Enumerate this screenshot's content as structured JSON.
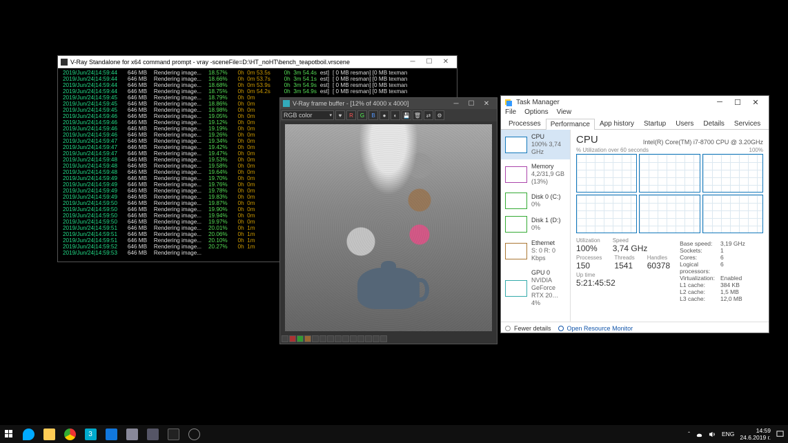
{
  "console": {
    "title": "V-Ray Standalone for x64 command prompt - vray  -sceneFile=D:\\HT_noHT\\bench_teapotboil.vrscene",
    "lines": [
      {
        "ts": "2019/Jun/24|14:59:44",
        "mb": "646",
        "pct": "18.57%",
        "t0": "0h  0m 53.5s",
        "t1": "0h  3m 54.4s",
        "tm": "[ 0 MB resman] [0 MB texman"
      },
      {
        "ts": "2019/Jun/24|14:59:44",
        "mb": "646",
        "pct": "18.66%",
        "t0": "0h  0m 53.7s",
        "t1": "0h  3m 54.1s",
        "tm": "[ 0 MB resman] [0 MB texman"
      },
      {
        "ts": "2019/Jun/24|14:59:44",
        "mb": "646",
        "pct": "18.68%",
        "t0": "0h  0m 53.9s",
        "t1": "0h  3m 54.9s",
        "tm": "[ 0 MB resman] [0 MB texman"
      },
      {
        "ts": "2019/Jun/24|14:59:44",
        "mb": "646",
        "pct": "18.75%",
        "t0": "0h  0m 54.2s",
        "t1": "0h  3m 54.9s",
        "tm": "[ 0 MB resman] [0 MB texman"
      },
      {
        "ts": "2019/Jun/24|14:59:45",
        "mb": "646",
        "pct": "18.79%",
        "t0": "0h  0m",
        "t1": "",
        "tm": ""
      },
      {
        "ts": "2019/Jun/24|14:59:45",
        "mb": "646",
        "pct": "18.86%",
        "t0": "0h  0m",
        "t1": "",
        "tm": ""
      },
      {
        "ts": "2019/Jun/24|14:59:45",
        "mb": "646",
        "pct": "18.98%",
        "t0": "0h  0m",
        "t1": "",
        "tm": ""
      },
      {
        "ts": "2019/Jun/24|14:59:46",
        "mb": "646",
        "pct": "19.05%",
        "t0": "0h  0m",
        "t1": "",
        "tm": ""
      },
      {
        "ts": "2019/Jun/24|14:59:46",
        "mb": "646",
        "pct": "19.12%",
        "t0": "0h  0m",
        "t1": "",
        "tm": ""
      },
      {
        "ts": "2019/Jun/24|14:59:46",
        "mb": "646",
        "pct": "19.19%",
        "t0": "0h  0m",
        "t1": "",
        "tm": ""
      },
      {
        "ts": "2019/Jun/24|14:59:46",
        "mb": "646",
        "pct": "19.26%",
        "t0": "0h  0m",
        "t1": "",
        "tm": ""
      },
      {
        "ts": "2019/Jun/24|14:59:47",
        "mb": "646",
        "pct": "19.34%",
        "t0": "0h  0m",
        "t1": "",
        "tm": ""
      },
      {
        "ts": "2019/Jun/24|14:59:47",
        "mb": "646",
        "pct": "19.42%",
        "t0": "0h  0m",
        "t1": "",
        "tm": ""
      },
      {
        "ts": "2019/Jun/24|14:59:47",
        "mb": "646",
        "pct": "19.47%",
        "t0": "0h  0m",
        "t1": "",
        "tm": ""
      },
      {
        "ts": "2019/Jun/24|14:59:48",
        "mb": "646",
        "pct": "19.53%",
        "t0": "0h  0m",
        "t1": "",
        "tm": ""
      },
      {
        "ts": "2019/Jun/24|14:59:48",
        "mb": "646",
        "pct": "19.58%",
        "t0": "0h  0m",
        "t1": "",
        "tm": ""
      },
      {
        "ts": "2019/Jun/24|14:59:48",
        "mb": "646",
        "pct": "19.64%",
        "t0": "0h  0m",
        "t1": "",
        "tm": ""
      },
      {
        "ts": "2019/Jun/24|14:59:49",
        "mb": "646",
        "pct": "19.70%",
        "t0": "0h  0m",
        "t1": "",
        "tm": ""
      },
      {
        "ts": "2019/Jun/24|14:59:49",
        "mb": "646",
        "pct": "19.76%",
        "t0": "0h  0m",
        "t1": "",
        "tm": ""
      },
      {
        "ts": "2019/Jun/24|14:59:49",
        "mb": "646",
        "pct": "19.78%",
        "t0": "0h  0m",
        "t1": "",
        "tm": ""
      },
      {
        "ts": "2019/Jun/24|14:59:49",
        "mb": "646",
        "pct": "19.83%",
        "t0": "0h  0m",
        "t1": "",
        "tm": ""
      },
      {
        "ts": "2019/Jun/24|14:59:50",
        "mb": "646",
        "pct": "19.87%",
        "t0": "0h  0m",
        "t1": "",
        "tm": ""
      },
      {
        "ts": "2019/Jun/24|14:59:50",
        "mb": "646",
        "pct": "19.90%",
        "t0": "0h  0m",
        "t1": "",
        "tm": ""
      },
      {
        "ts": "2019/Jun/24|14:59:50",
        "mb": "646",
        "pct": "19.94%",
        "t0": "0h  0m",
        "t1": "",
        "tm": ""
      },
      {
        "ts": "2019/Jun/24|14:59:50",
        "mb": "646",
        "pct": "19.97%",
        "t0": "0h  0m",
        "t1": "",
        "tm": ""
      },
      {
        "ts": "2019/Jun/24|14:59:51",
        "mb": "646",
        "pct": "20.01%",
        "t0": "0h  1m",
        "t1": "",
        "tm": ""
      },
      {
        "ts": "2019/Jun/24|14:59:51",
        "mb": "646",
        "pct": "20.06%",
        "t0": "0h  1m",
        "t1": "",
        "tm": ""
      },
      {
        "ts": "2019/Jun/24|14:59:51",
        "mb": "646",
        "pct": "20.10%",
        "t0": "0h  1m",
        "t1": "",
        "tm": ""
      },
      {
        "ts": "2019/Jun/24|14:59:52",
        "mb": "646",
        "pct": "20.27%",
        "t0": "0h  1m",
        "t1": "",
        "tm": ""
      },
      {
        "ts": "2019/Jun/24|14:59:53",
        "mb": "646",
        "pct": "",
        "t0": "",
        "t1": "",
        "tm": ""
      }
    ]
  },
  "vfb": {
    "title": "V-Ray frame buffer - [12% of 4000 x 4000]",
    "channel": "RGB color",
    "buttons_rgb": [
      "R",
      "G",
      "B"
    ]
  },
  "tm": {
    "title": "Task Manager",
    "menu": [
      "File",
      "Options",
      "View"
    ],
    "tabs": [
      "Processes",
      "Performance",
      "App history",
      "Startup",
      "Users",
      "Details",
      "Services"
    ],
    "active_tab": 1,
    "side": [
      {
        "kind": "cpu",
        "name": "CPU",
        "val": "100% 3,74 GHz"
      },
      {
        "kind": "mem",
        "name": "Memory",
        "val": "4,2/31,9 GB (13%)"
      },
      {
        "kind": "disk",
        "name": "Disk 0 (C:)",
        "val": "0%"
      },
      {
        "kind": "disk",
        "name": "Disk 1 (D:)",
        "val": "0%"
      },
      {
        "kind": "eth",
        "name": "Ethernet",
        "val": "S: 0 R: 0 Kbps"
      },
      {
        "kind": "gpu",
        "name": "GPU 0",
        "val": "NVIDIA GeForce RTX 20… 4%"
      }
    ],
    "main": {
      "heading": "CPU",
      "model": "Intel(R) Core(TM) i7-8700 CPU @ 3.20GHz",
      "graph_label": "% Utilization over 60 seconds",
      "graph_max": "100%",
      "stats": [
        {
          "label": "Utilization",
          "val": "100%"
        },
        {
          "label": "Speed",
          "val": "3,74 GHz"
        }
      ],
      "stats2": [
        {
          "label": "Processes",
          "val": "150"
        },
        {
          "label": "Threads",
          "val": "1541"
        },
        {
          "label": "Handles",
          "val": "60378"
        }
      ],
      "uptime_label": "Up time",
      "uptime": "5:21:45:52",
      "details": [
        {
          "k": "Base speed:",
          "v": "3,19 GHz"
        },
        {
          "k": "Sockets:",
          "v": "1"
        },
        {
          "k": "Cores:",
          "v": "6"
        },
        {
          "k": "Logical processors:",
          "v": "6"
        },
        {
          "k": "Virtualization:",
          "v": "Enabled"
        },
        {
          "k": "L1 cache:",
          "v": "384 KB"
        },
        {
          "k": "L2 cache:",
          "v": "1,5 MB"
        },
        {
          "k": "L3 cache:",
          "v": "12,0 MB"
        }
      ]
    },
    "footer": {
      "fewer": "Fewer details",
      "resmon": "Open Resource Monitor"
    }
  },
  "taskbar": {
    "tray_lang": "ENG",
    "time": "14:59",
    "date": "24.6.2019 г."
  }
}
